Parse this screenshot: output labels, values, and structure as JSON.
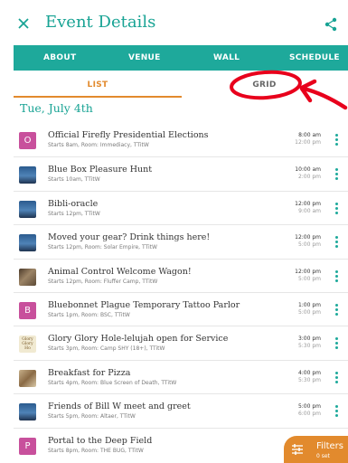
{
  "header": {
    "title": "Event Details"
  },
  "tabs": [
    {
      "label": "ABOUT"
    },
    {
      "label": "VENUE"
    },
    {
      "label": "WALL"
    },
    {
      "label": "SCHEDULE"
    }
  ],
  "view_toggle": {
    "list_label": "LIST",
    "grid_label": "GRID",
    "selected": "LIST"
  },
  "date_heading": "Tue, July 4th",
  "colors": {
    "accent": "#1ea99b",
    "title": "#18a394",
    "highlight": "#e28a2d",
    "avatar": "#c8509c",
    "annotation": "#e8001c"
  },
  "events": [
    {
      "thumb": "letter",
      "letter": "O",
      "title": "Official Firefly Presidential Elections",
      "subtitle": "Starts 8am, Room: Immediacy, TTitW",
      "start": "8:00 am",
      "end": "12:00 pm"
    },
    {
      "thumb": "photo-sky",
      "letter": "",
      "title": "Blue Box Pleasure Hunt",
      "subtitle": "Starts 10am, TTitW",
      "start": "10:00 am",
      "end": "2:00 pm"
    },
    {
      "thumb": "photo-sky",
      "letter": "",
      "title": "Bibli-oracle",
      "subtitle": "Starts 12pm, TTitW",
      "start": "12:00 pm",
      "end": "9:00 am"
    },
    {
      "thumb": "photo-sky",
      "letter": "",
      "title": "Moved your gear? Drink things here!",
      "subtitle": "Starts 12pm, Room: Solar Empire, TTitW",
      "start": "12:00 pm",
      "end": "5:00 pm"
    },
    {
      "thumb": "photo-animal",
      "letter": "",
      "title": "Animal Control Welcome Wagon!",
      "subtitle": "Starts 12pm, Room: Fluffer Camp, TTitW",
      "start": "12:00 pm",
      "end": "5:00 pm"
    },
    {
      "thumb": "letter",
      "letter": "B",
      "title": "Bluebonnet Plague Temporary Tattoo Parlor",
      "subtitle": "Starts 1pm, Room: BSC, TTitW",
      "start": "1:00 pm",
      "end": "5:00 pm"
    },
    {
      "thumb": "photo-text",
      "letter": "Glory Glory Ho",
      "title": "Glory Glory Hole-lelujah open for Service",
      "subtitle": "Starts 3pm, Room: Camp SHY (18+), TTitW",
      "start": "3:00 pm",
      "end": "5:30 pm"
    },
    {
      "thumb": "photo-dish",
      "letter": "",
      "title": "Breakfast for Pizza",
      "subtitle": "Starts 4pm, Room: Blue Screen of Death, TTitW",
      "start": "4:00 pm",
      "end": "5:30 pm"
    },
    {
      "thumb": "photo-sky",
      "letter": "",
      "title": "Friends of Bill W meet and greet",
      "subtitle": "Starts 5pm, Room: Altaer, TTitW",
      "start": "5:00 pm",
      "end": "6:00 pm"
    },
    {
      "thumb": "letter",
      "letter": "P",
      "title": "Portal to the Deep Field",
      "subtitle": "Starts 8pm, Room: THE BUG, TTitW",
      "start": "",
      "end": ""
    }
  ],
  "filters": {
    "label": "Filters",
    "count": "0 set"
  },
  "icons": {
    "close": "close-icon",
    "share": "share-icon",
    "menu": "more-vert-icon",
    "filters": "sliders-icon"
  }
}
